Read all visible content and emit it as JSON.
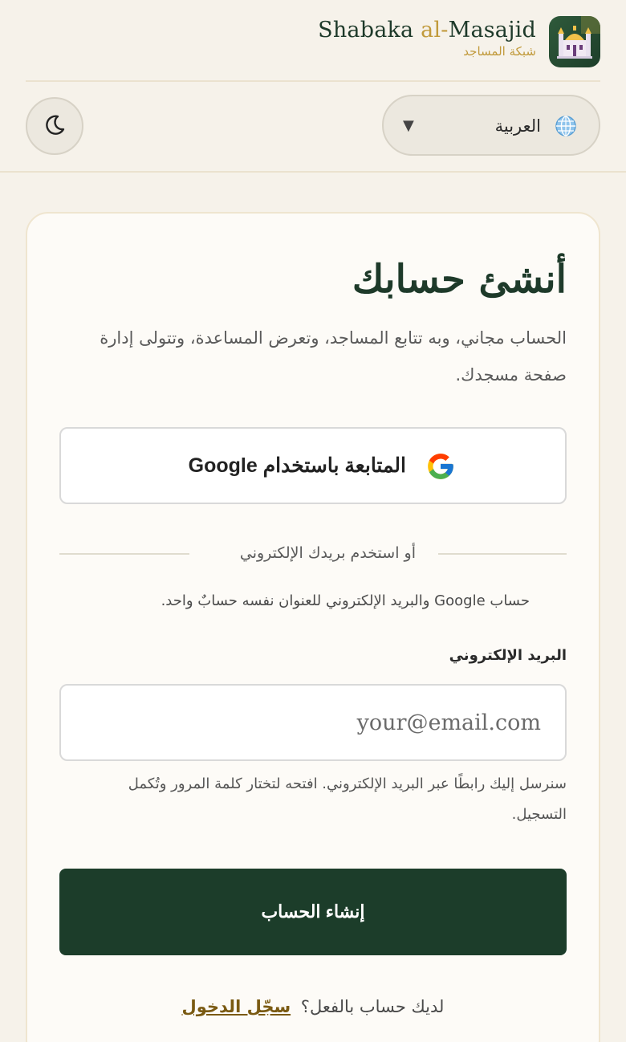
{
  "brand": {
    "name_prefix": "Shabaka ",
    "name_al": "al-",
    "name_suffix": "Masajid",
    "subtitle": "شبكة المساجد"
  },
  "toolbar": {
    "language_label": "العربية",
    "language_icon": "globe-icon",
    "theme_icon": "moon-icon"
  },
  "signup": {
    "title": "أنشئ حسابك",
    "lead": "الحساب مجاني، وبه تتابع المساجد، وتعرض المساعدة، وتتولى إدارة صفحة مسجدك.",
    "google_button": "المتابعة باستخدام Google",
    "divider_text": "أو استخدم بريدك الإلكتروني",
    "note": "حساب Google والبريد الإلكتروني للعنوان نفسه حسابٌ واحد.",
    "email_label": "البريد الإلكتروني",
    "email_placeholder": "your@email.com",
    "email_help": "سنرسل إليك رابطًا عبر البريد الإلكتروني. افتحه لتختار كلمة المرور وتُكمل التسجيل.",
    "submit_button": "إنشاء الحساب",
    "have_account": "لديك حساب بالفعل؟",
    "login_link": "سجّل الدخول"
  },
  "colors": {
    "brand_green": "#1c3d2a",
    "accent_gold": "#c19a3b",
    "background": "#f6f2ea"
  }
}
